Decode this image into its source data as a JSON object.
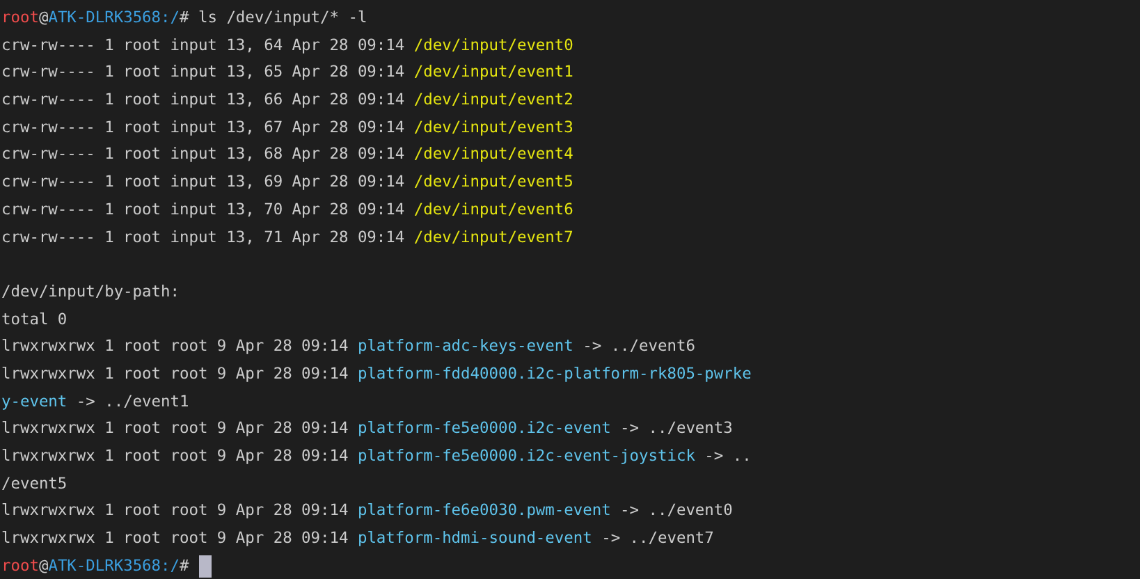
{
  "lines": [
    {
      "segments": [
        {
          "kind": "user",
          "text": "root"
        },
        {
          "kind": "plain",
          "text": "@"
        },
        {
          "kind": "host",
          "text": "ATK-DLRK3568"
        },
        {
          "kind": "host",
          "text": ":/"
        },
        {
          "kind": "plain",
          "text": "# ls /dev/input/* -l"
        }
      ]
    },
    {
      "segments": [
        {
          "kind": "plain",
          "text": "crw-rw---- 1 root input 13, 64 Apr 28 09:14 "
        },
        {
          "kind": "device",
          "text": "/dev/input/event0"
        }
      ]
    },
    {
      "segments": [
        {
          "kind": "plain",
          "text": "crw-rw---- 1 root input 13, 65 Apr 28 09:14 "
        },
        {
          "kind": "device",
          "text": "/dev/input/event1"
        }
      ]
    },
    {
      "segments": [
        {
          "kind": "plain",
          "text": "crw-rw---- 1 root input 13, 66 Apr 28 09:14 "
        },
        {
          "kind": "device",
          "text": "/dev/input/event2"
        }
      ]
    },
    {
      "segments": [
        {
          "kind": "plain",
          "text": "crw-rw---- 1 root input 13, 67 Apr 28 09:14 "
        },
        {
          "kind": "device",
          "text": "/dev/input/event3"
        }
      ]
    },
    {
      "segments": [
        {
          "kind": "plain",
          "text": "crw-rw---- 1 root input 13, 68 Apr 28 09:14 "
        },
        {
          "kind": "device",
          "text": "/dev/input/event4"
        }
      ]
    },
    {
      "segments": [
        {
          "kind": "plain",
          "text": "crw-rw---- 1 root input 13, 69 Apr 28 09:14 "
        },
        {
          "kind": "device",
          "text": "/dev/input/event5"
        }
      ]
    },
    {
      "segments": [
        {
          "kind": "plain",
          "text": "crw-rw---- 1 root input 13, 70 Apr 28 09:14 "
        },
        {
          "kind": "device",
          "text": "/dev/input/event6"
        }
      ]
    },
    {
      "segments": [
        {
          "kind": "plain",
          "text": "crw-rw---- 1 root input 13, 71 Apr 28 09:14 "
        },
        {
          "kind": "device",
          "text": "/dev/input/event7"
        }
      ]
    },
    {
      "blank": true
    },
    {
      "segments": [
        {
          "kind": "plain",
          "text": "/dev/input/by-path:"
        }
      ]
    },
    {
      "segments": [
        {
          "kind": "plain",
          "text": "total 0"
        }
      ]
    },
    {
      "segments": [
        {
          "kind": "plain",
          "text": "lrwxrwxrwx 1 root root 9 Apr 28 09:14 "
        },
        {
          "kind": "link",
          "text": "platform-adc-keys-event"
        },
        {
          "kind": "plain",
          "text": " -> ../event6"
        }
      ]
    },
    {
      "segments": [
        {
          "kind": "plain",
          "text": "lrwxrwxrwx 1 root root 9 Apr 28 09:14 "
        },
        {
          "kind": "link",
          "text": "platform-fdd40000.i2c-platform-rk805-pwrke"
        }
      ]
    },
    {
      "segments": [
        {
          "kind": "link",
          "text": "y-event"
        },
        {
          "kind": "plain",
          "text": " -> ../event1"
        }
      ]
    },
    {
      "segments": [
        {
          "kind": "plain",
          "text": "lrwxrwxrwx 1 root root 9 Apr 28 09:14 "
        },
        {
          "kind": "link",
          "text": "platform-fe5e0000.i2c-event"
        },
        {
          "kind": "plain",
          "text": " -> ../event3"
        }
      ]
    },
    {
      "segments": [
        {
          "kind": "plain",
          "text": "lrwxrwxrwx 1 root root 9 Apr 28 09:14 "
        },
        {
          "kind": "link",
          "text": "platform-fe5e0000.i2c-event-joystick"
        },
        {
          "kind": "plain",
          "text": " -> .."
        }
      ]
    },
    {
      "segments": [
        {
          "kind": "plain",
          "text": "/event5"
        }
      ]
    },
    {
      "segments": [
        {
          "kind": "plain",
          "text": "lrwxrwxrwx 1 root root 9 Apr 28 09:14 "
        },
        {
          "kind": "link",
          "text": "platform-fe6e0030.pwm-event"
        },
        {
          "kind": "plain",
          "text": " -> ../event0"
        }
      ]
    },
    {
      "segments": [
        {
          "kind": "plain",
          "text": "lrwxrwxrwx 1 root root 9 Apr 28 09:14 "
        },
        {
          "kind": "link",
          "text": "platform-hdmi-sound-event"
        },
        {
          "kind": "plain",
          "text": " -> ../event7"
        }
      ]
    },
    {
      "segments": [
        {
          "kind": "user",
          "text": "root"
        },
        {
          "kind": "plain",
          "text": "@"
        },
        {
          "kind": "host",
          "text": "ATK-DLRK3568"
        },
        {
          "kind": "host",
          "text": ":/"
        },
        {
          "kind": "plain",
          "text": "#"
        }
      ],
      "cursor": true
    }
  ]
}
